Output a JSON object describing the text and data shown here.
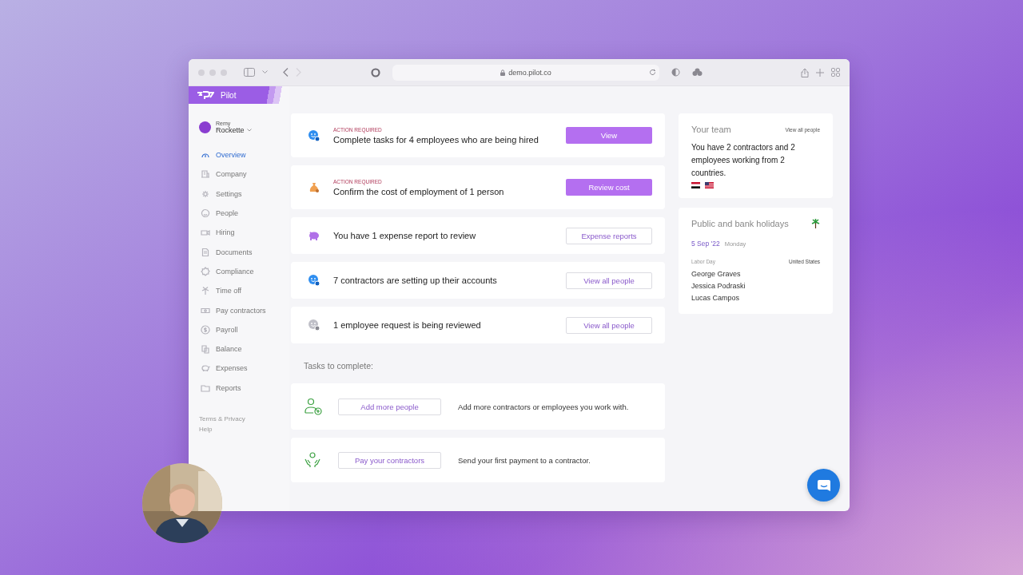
{
  "browser": {
    "url": "demo.pilot.co"
  },
  "sidebar": {
    "brand": "Pilot",
    "user": {
      "first_name": "Remy",
      "last_name": "Rockette"
    },
    "items": [
      {
        "label": "Overview",
        "selected": true
      },
      {
        "label": "Company",
        "selected": false
      },
      {
        "label": "Settings",
        "selected": false
      },
      {
        "label": "People",
        "selected": false
      },
      {
        "label": "Hiring",
        "selected": false
      },
      {
        "label": "Documents",
        "selected": false
      },
      {
        "label": "Compliance",
        "selected": false
      },
      {
        "label": "Time off",
        "selected": false
      },
      {
        "label": "Pay contractors",
        "selected": false
      },
      {
        "label": "Payroll",
        "selected": false
      },
      {
        "label": "Balance",
        "selected": false
      },
      {
        "label": "Expenses",
        "selected": false
      },
      {
        "label": "Reports",
        "selected": false
      }
    ],
    "footer_links": [
      "Terms & Privacy",
      "Help"
    ]
  },
  "alerts": [
    {
      "tag": "ACTION REQUIRED",
      "text": "Complete tasks for 4 employees who are being hired",
      "button": {
        "label": "View",
        "kind": "filled"
      }
    },
    {
      "tag": "ACTION REQUIRED",
      "text": "Confirm the cost of employment of 1 person",
      "button": {
        "label": "Review cost",
        "kind": "filled"
      }
    },
    {
      "text": "You have 1 expense report to review",
      "button": {
        "label": "Expense reports",
        "kind": "outline"
      }
    },
    {
      "text": "7 contractors are setting up their accounts",
      "button": {
        "label": "View all people",
        "kind": "outline"
      }
    },
    {
      "text": "1 employee request is being reviewed",
      "button": {
        "label": "View all people",
        "kind": "outline"
      }
    }
  ],
  "tasks_heading": "Tasks to complete:",
  "tasks": [
    {
      "button": "Add more people",
      "text": "Add more contractors or employees you work with."
    },
    {
      "button": "Pay your contractors",
      "text": "Send your first payment to a contractor."
    }
  ],
  "team": {
    "title": "Your team",
    "link": "View all people",
    "text": "You have 2 contractors and 2 employees working from 2 countries."
  },
  "holidays": {
    "title": "Public and bank holidays",
    "date": "5 Sep '22",
    "weekday": "Monday",
    "holiday": "Labor Day",
    "country": "United States",
    "people": [
      "George Graves",
      "Jessica Podraski",
      "Lucas Campos"
    ]
  }
}
